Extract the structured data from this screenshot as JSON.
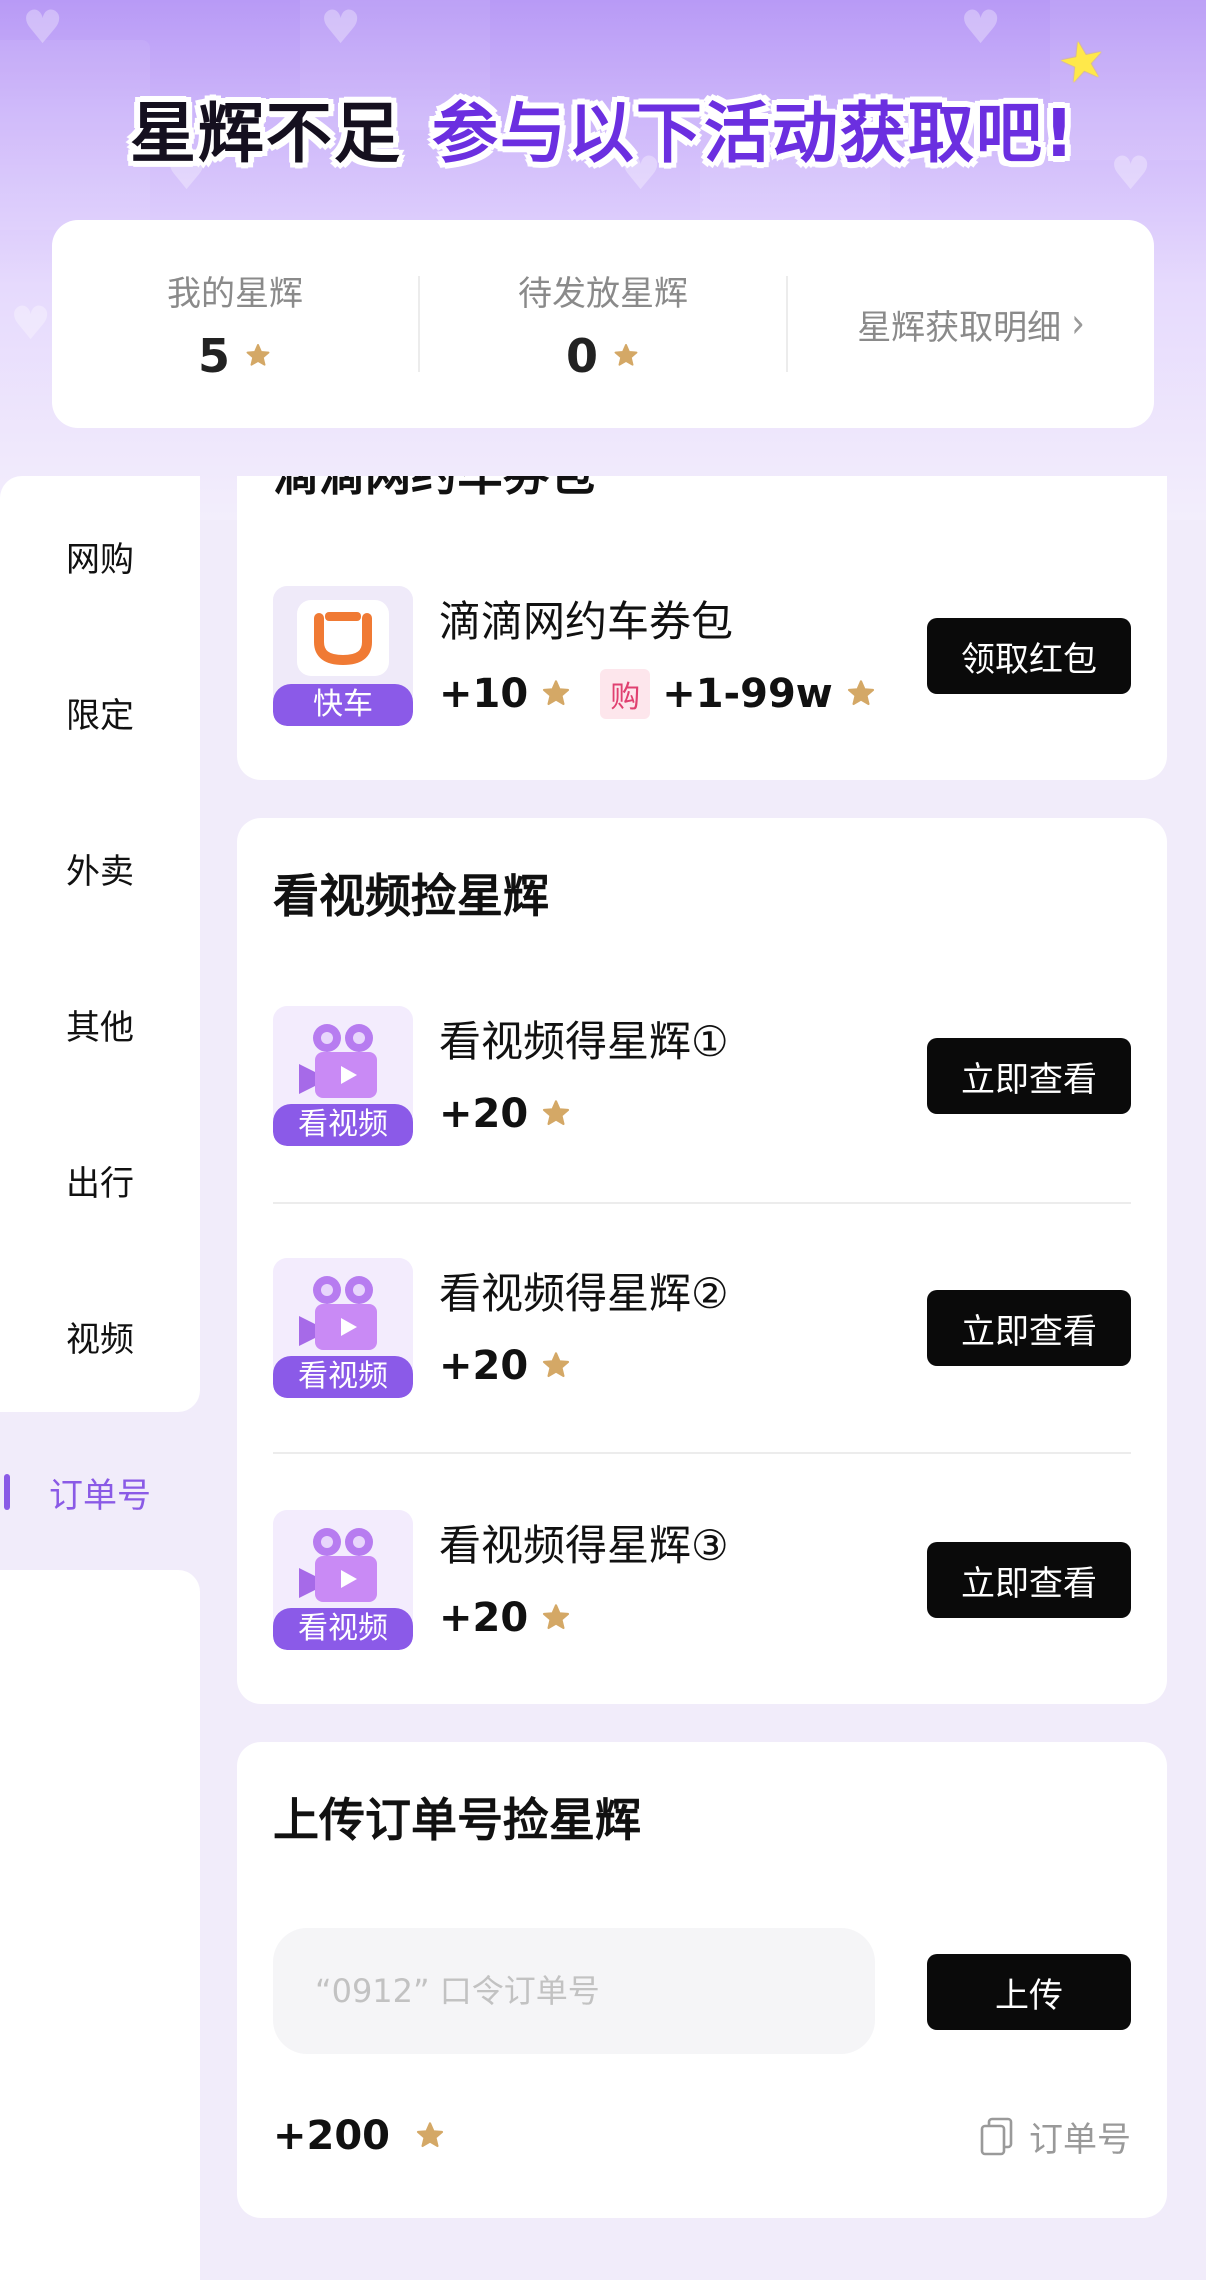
{
  "header": {
    "title_part1": "星辉不足",
    "title_part2": "参与以下活动获取吧!"
  },
  "stats": {
    "my_label": "我的星辉",
    "my_value": "5",
    "pending_label": "待发放星辉",
    "pending_value": "0",
    "detail_link": "星辉获取明细"
  },
  "sidebar": {
    "items": [
      {
        "label": "网购"
      },
      {
        "label": "限定"
      },
      {
        "label": "外卖"
      },
      {
        "label": "其他"
      },
      {
        "label": "出行"
      },
      {
        "label": "视频"
      },
      {
        "label": "订单号"
      }
    ],
    "active": "订单号"
  },
  "travel_section": {
    "title": "滴滴网约车券包",
    "item": {
      "thumb_caption": "快车",
      "title": "滴滴网约车券包",
      "reward": "+10",
      "buy_tag": "购",
      "buy_reward": "+1-99w",
      "button": "领取红包"
    }
  },
  "video_section": {
    "title": "看视频捡星辉",
    "items": [
      {
        "thumb_caption": "看视频",
        "title": "看视频得星辉①",
        "reward": "+20",
        "button": "立即查看"
      },
      {
        "thumb_caption": "看视频",
        "title": "看视频得星辉②",
        "reward": "+20",
        "button": "立即查看"
      },
      {
        "thumb_caption": "看视频",
        "title": "看视频得星辉③",
        "reward": "+20",
        "button": "立即查看"
      }
    ]
  },
  "order_section": {
    "title": "上传订单号捡星辉",
    "input_placeholder": "“0912” 口令订单号",
    "upload_button": "上传",
    "reward": "+200",
    "copy_link": "订单号"
  },
  "colors": {
    "accent": "#8a5ae6",
    "title_purple": "#6b2fe0",
    "star_gold": "#d4a866",
    "button_black": "#0a0a0a"
  },
  "icons": {
    "star": "star-icon",
    "chevron": "chevron-right-icon",
    "copy": "copy-icon",
    "didi": "didi-logo-icon",
    "video": "video-camera-icon"
  }
}
